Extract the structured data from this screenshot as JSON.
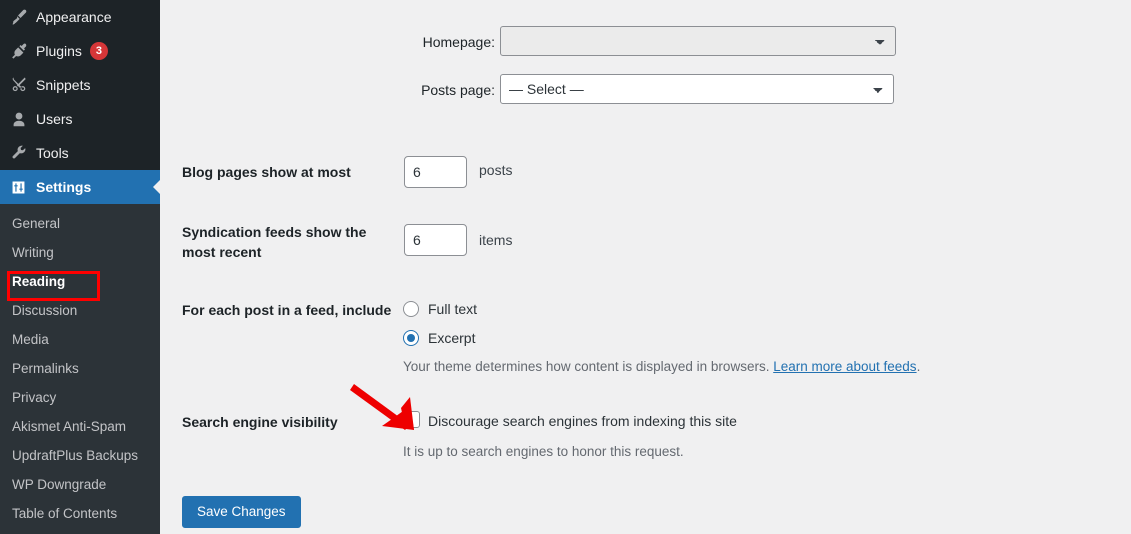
{
  "sidebar": {
    "menu": [
      {
        "label": "Appearance",
        "icon": "paintbrush-icon",
        "badge": null,
        "current": false
      },
      {
        "label": "Plugins",
        "icon": "plug-icon",
        "badge": "3",
        "current": false
      },
      {
        "label": "Snippets",
        "icon": "scissors-icon",
        "badge": null,
        "current": false
      },
      {
        "label": "Users",
        "icon": "user-icon",
        "badge": null,
        "current": false
      },
      {
        "label": "Tools",
        "icon": "wrench-icon",
        "badge": null,
        "current": false
      },
      {
        "label": "Settings",
        "icon": "sliders-icon",
        "badge": null,
        "current": true
      }
    ],
    "submenu": [
      {
        "label": "General",
        "current": false
      },
      {
        "label": "Writing",
        "current": false
      },
      {
        "label": "Reading",
        "current": true
      },
      {
        "label": "Discussion",
        "current": false
      },
      {
        "label": "Media",
        "current": false
      },
      {
        "label": "Permalinks",
        "current": false
      },
      {
        "label": "Privacy",
        "current": false
      },
      {
        "label": "Akismet Anti-Spam",
        "current": false
      },
      {
        "label": "UpdraftPlus Backups",
        "current": false
      },
      {
        "label": "WP Downgrade",
        "current": false
      },
      {
        "label": "Table of Contents",
        "current": false
      }
    ]
  },
  "form": {
    "homepage": {
      "label": "Homepage:",
      "value": "",
      "options": [
        ""
      ]
    },
    "posts_page": {
      "label": "Posts page:",
      "value": "— Select —",
      "options": [
        "— Select —"
      ]
    },
    "blog_pages": {
      "label": "Blog pages show at most",
      "value": "6",
      "unit": "posts"
    },
    "syndication": {
      "label": "Syndication feeds show the most recent",
      "value": "6",
      "unit": "items"
    },
    "feed_include": {
      "label": "For each post in a feed, include",
      "options": [
        {
          "label": "Full text",
          "checked": false
        },
        {
          "label": "Excerpt",
          "checked": true
        }
      ],
      "description_prefix": "Your theme determines how content is displayed in browsers. ",
      "description_link": "Learn more about feeds",
      "description_suffix": "."
    },
    "search_visibility": {
      "label": "Search engine visibility",
      "checkbox_label": "Discourage search engines from indexing this site",
      "checked": false,
      "description": "It is up to search engines to honor this request."
    },
    "save_label": "Save Changes"
  },
  "annotations": {
    "arrow_color": "#ee0000",
    "highlight_color": "#ff0000",
    "highlight_target": "Reading"
  },
  "colors": {
    "sidebar_bg": "#1d2327",
    "submenu_bg": "#2c3338",
    "accent": "#2271b1",
    "badge": "#d63638",
    "content_bg": "#f0f0f1"
  }
}
